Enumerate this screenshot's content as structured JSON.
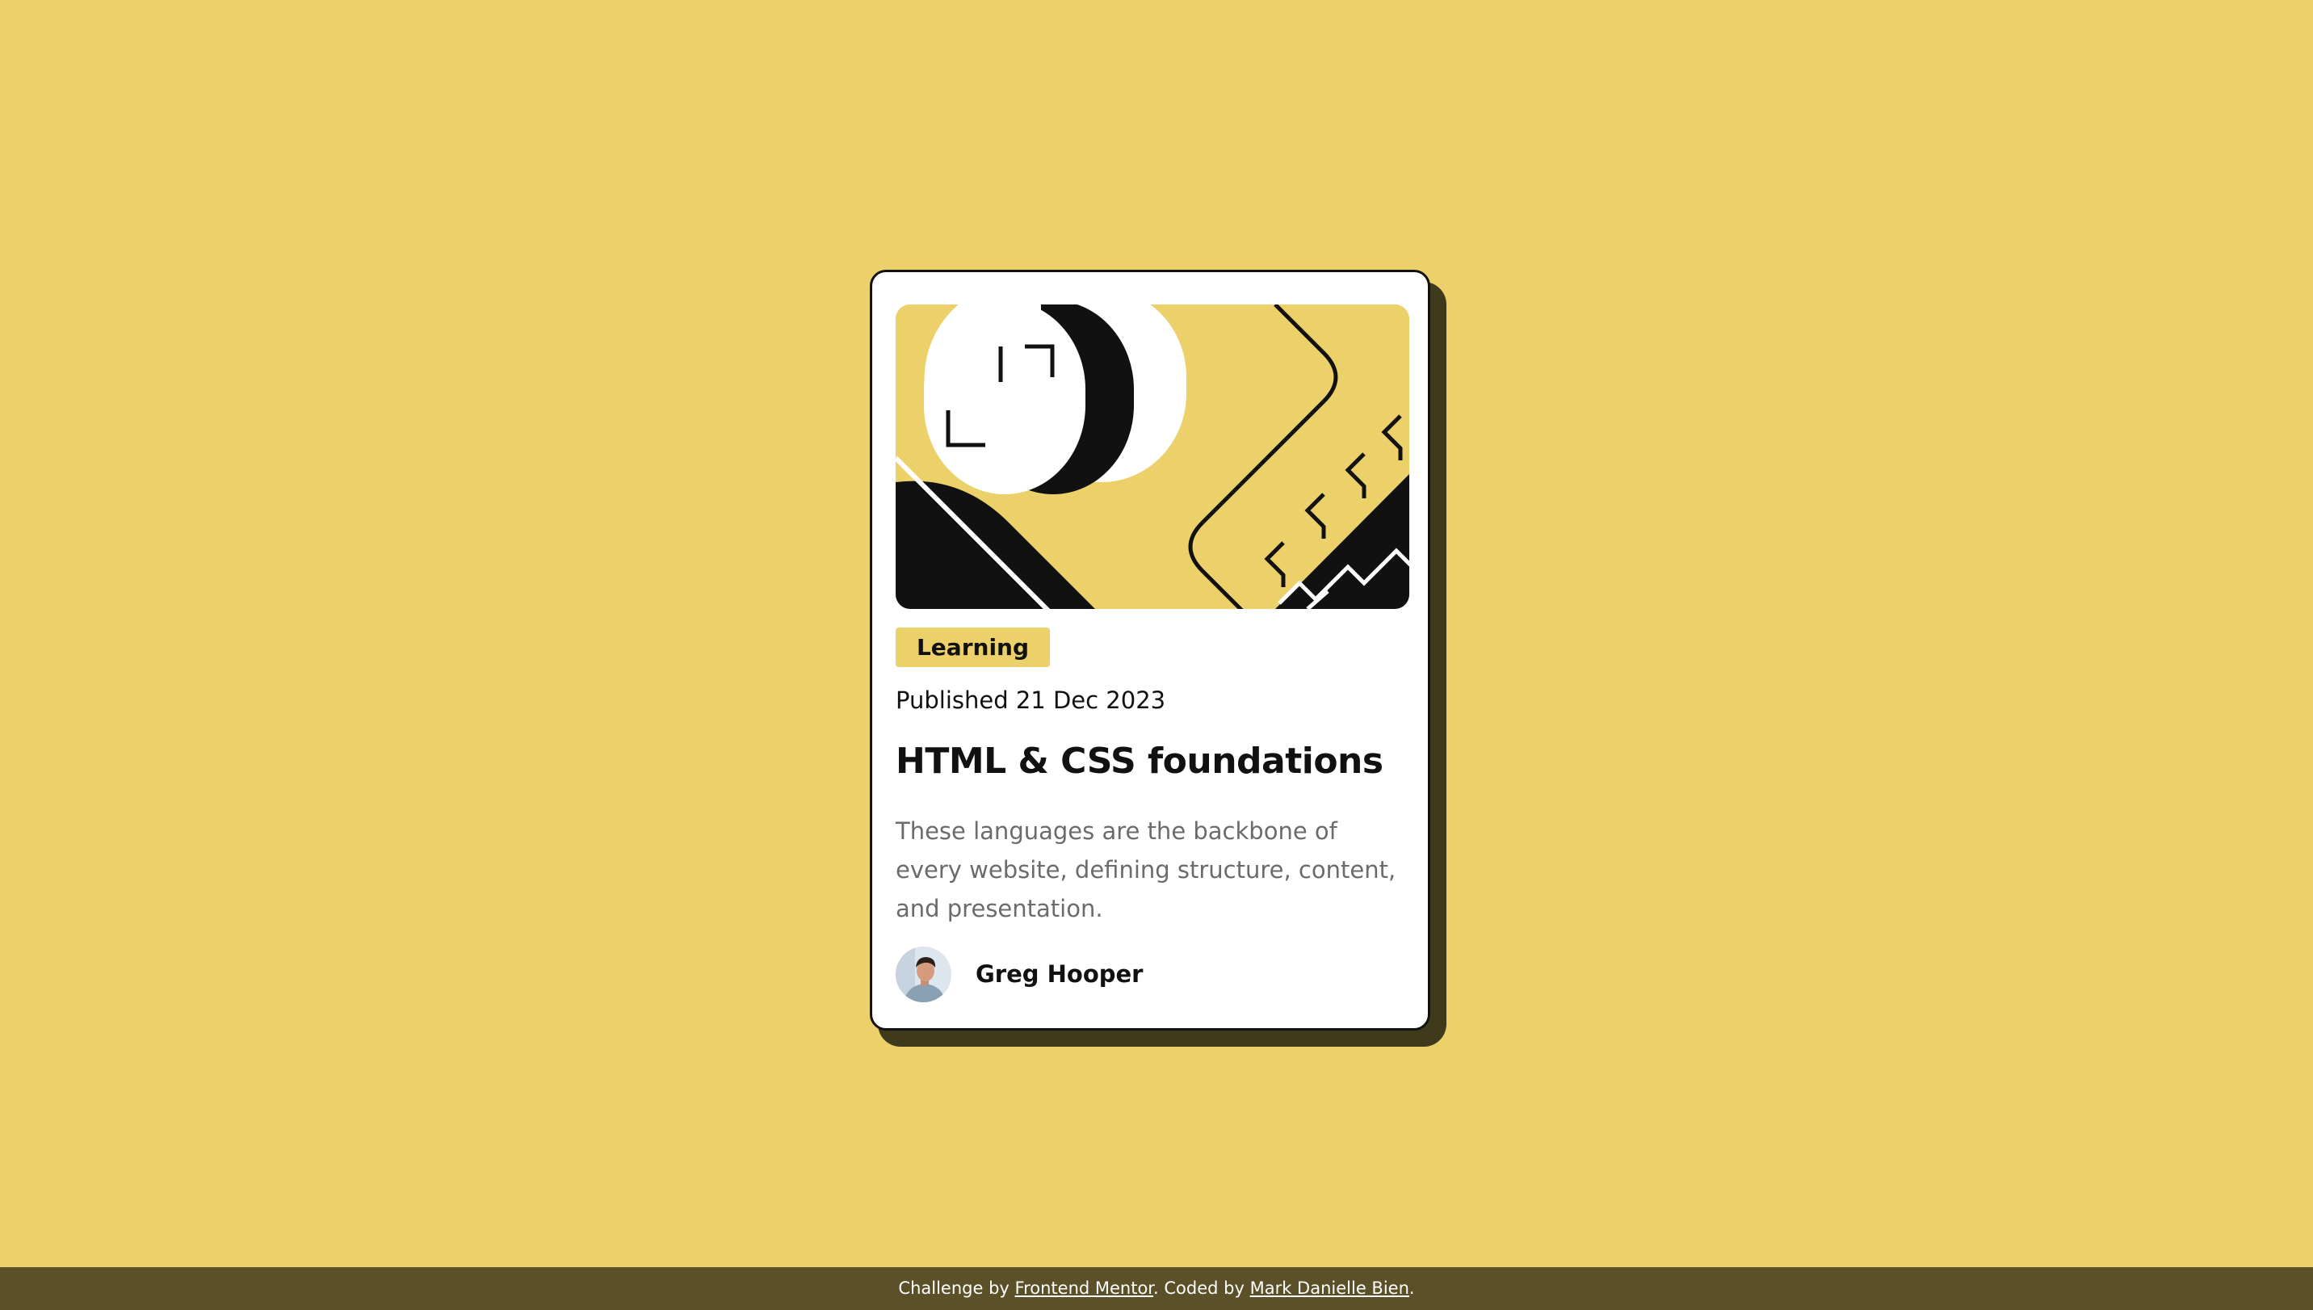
{
  "blog_card": {
    "category_tag": "Learning",
    "published": "Published 21 Dec 2023",
    "title": "HTML & CSS foundations",
    "description": "These languages are the backbone of every website, defining structure, content, and presentation.",
    "author_name": "Greg Hooper",
    "hero_image": "illustration-article"
  },
  "footer": {
    "prefix": "Challenge by ",
    "challenge_link": "Frontend Mentor",
    "middle": ". Coded by ",
    "author_link": "Mark Danielle Bien",
    "suffix": "."
  },
  "colors": {
    "background": "#ecd16a",
    "card": "#ffffff",
    "ink": "#111111",
    "shadow": "#403a1d",
    "footer": "#5b5027",
    "muted_text": "#6b6b6b"
  }
}
